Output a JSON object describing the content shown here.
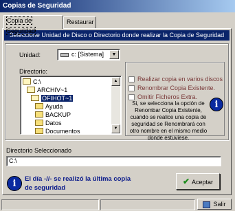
{
  "window": {
    "title": "Copias de Seguridad"
  },
  "tabs": [
    {
      "label": "Copia de Seguridad",
      "active": true
    },
    {
      "label": "Restaurar",
      "active": false
    }
  ],
  "banner": "Seleccione Unidad de Disco o Directorio donde realizar la Copia de Seguridad",
  "drive": {
    "label": "Unidad:",
    "value": "c: [Sistema]",
    "icon": "drive-icon"
  },
  "directory": {
    "label": "Directorio:",
    "items": [
      {
        "name": "C:\\",
        "icon": "folder-open-icon",
        "selected": false
      },
      {
        "name": "ARCHIV~1",
        "icon": "folder-open-icon",
        "selected": false
      },
      {
        "name": "OFIHOT~1",
        "icon": "folder-open-icon",
        "selected": true
      },
      {
        "name": "Ayuda",
        "icon": "folder-icon",
        "selected": false
      },
      {
        "name": "BACKUP",
        "icon": "folder-icon",
        "selected": false
      },
      {
        "name": "Datos",
        "icon": "folder-icon",
        "selected": false
      },
      {
        "name": "Documentos",
        "icon": "folder-icon",
        "selected": false
      }
    ]
  },
  "options": {
    "checkboxes": [
      {
        "label": "Realizar copia en varios discos",
        "checked": false
      },
      {
        "label": "Renombrar Copia Existente.",
        "checked": false
      },
      {
        "label": "Omitir Ficheros Extra.",
        "checked": false
      }
    ],
    "note": "Si, se selecciona la opción de Renombar Copia Existente, cuando se realice una copia de seguridad se Renombrará con otro nombre en el mismo medio donde estuviese."
  },
  "selected_dir": {
    "label": "Directorio Seleccionado",
    "value": "C:\\"
  },
  "last_copy": "El día -//- se realizó la última copia de seguridad",
  "buttons": {
    "accept": "Aceptar",
    "exit": "Salir"
  },
  "colors": {
    "banner": "#0a246a",
    "text_info": "#0a1a8a",
    "checkbox_label": "#7a3a3a"
  }
}
